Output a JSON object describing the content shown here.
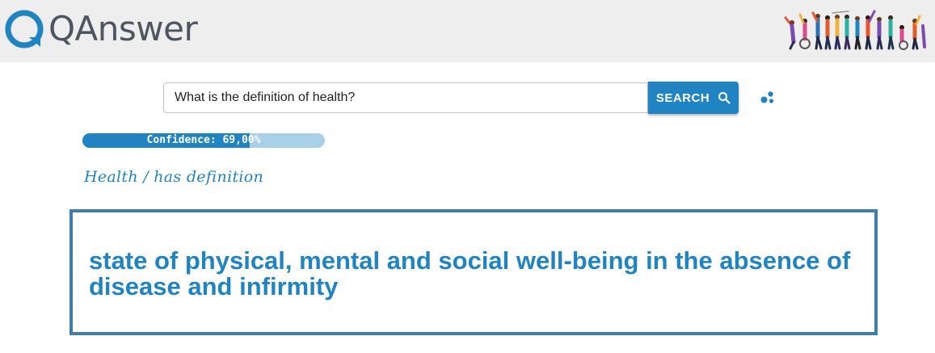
{
  "header": {
    "logo_text": "QAnswer",
    "people_illustration": "people-celebrating-illustration"
  },
  "search": {
    "query": "What is the definition of health?",
    "button_label": "SEARCH",
    "button_icon": "search-icon",
    "options_icon": "dots-icon"
  },
  "confidence": {
    "label": "Confidence: 69,00%",
    "value": 69.0
  },
  "result": {
    "breadcrumb": "Health / has definition",
    "answer": "state of physical, mental and social well-being in the absence of disease and infirmity"
  },
  "colors": {
    "accent": "#1f84c1",
    "accent_light": "#a8d0e8",
    "border": "#3d7ead",
    "header_bg": "#eeeeee",
    "logo_text": "#4d5560"
  }
}
